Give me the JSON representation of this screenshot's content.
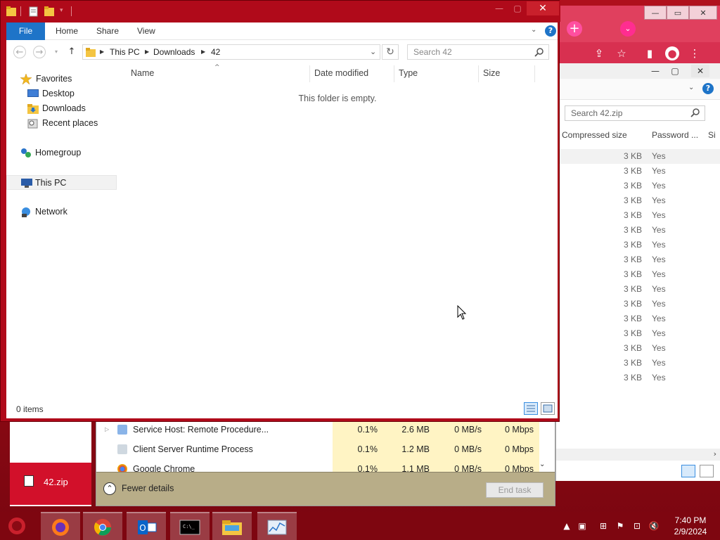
{
  "explorer": {
    "ribbon_tabs": [
      "File",
      "Home",
      "Share",
      "View"
    ],
    "breadcrumb": [
      "This PC",
      "Downloads",
      "42"
    ],
    "search_placeholder": "Search 42",
    "nav": {
      "favorites": "Favorites",
      "desktop": "Desktop",
      "downloads": "Downloads",
      "recent": "Recent places",
      "homegroup": "Homegroup",
      "this_pc": "This PC",
      "network": "Network"
    },
    "columns": [
      "Name",
      "Date modified",
      "Type",
      "Size"
    ],
    "empty_message": "This folder is empty.",
    "status": "0 items"
  },
  "zip_window": {
    "search_placeholder": "Search 42.zip",
    "columns": [
      "Compressed size",
      "Password ...",
      "Si"
    ],
    "rows": [
      {
        "size": "3 KB",
        "password": "Yes"
      },
      {
        "size": "3 KB",
        "password": "Yes"
      },
      {
        "size": "3 KB",
        "password": "Yes"
      },
      {
        "size": "3 KB",
        "password": "Yes"
      },
      {
        "size": "3 KB",
        "password": "Yes"
      },
      {
        "size": "3 KB",
        "password": "Yes"
      },
      {
        "size": "3 KB",
        "password": "Yes"
      },
      {
        "size": "3 KB",
        "password": "Yes"
      },
      {
        "size": "3 KB",
        "password": "Yes"
      },
      {
        "size": "3 KB",
        "password": "Yes"
      },
      {
        "size": "3 KB",
        "password": "Yes"
      },
      {
        "size": "3 KB",
        "password": "Yes"
      },
      {
        "size": "3 KB",
        "password": "Yes"
      },
      {
        "size": "3 KB",
        "password": "Yes"
      },
      {
        "size": "3 KB",
        "password": "Yes"
      },
      {
        "size": "3 KB",
        "password": "Yes"
      }
    ]
  },
  "task_manager": {
    "processes": [
      {
        "name": "Service Host: Remote Procedure...",
        "cpu": "0.1%",
        "memory": "2.6 MB",
        "disk": "0 MB/s",
        "network": "0 Mbps"
      },
      {
        "name": "Client Server Runtime Process",
        "cpu": "0.1%",
        "memory": "1.2 MB",
        "disk": "0 MB/s",
        "network": "0 Mbps"
      },
      {
        "name": "Google Chrome",
        "cpu": "0.1%",
        "memory": "1.1 MB",
        "disk": "0 MB/s",
        "network": "0 Mbps"
      }
    ],
    "fewer_details": "Fewer details",
    "end_task": "End task"
  },
  "left_panel": {
    "zip_label": "42.zip"
  },
  "taskbar": {
    "apps": [
      "firefox-icon",
      "chrome-icon",
      "outlook-icon",
      "cmd-icon",
      "file-explorer-icon",
      "task-manager-icon"
    ],
    "time": "7:40 PM",
    "date": "2/9/2024"
  },
  "colors": {
    "desktop": "#b0101c",
    "accent": "#1e74c8",
    "taskmgr_highlight": "#fff4c4"
  }
}
